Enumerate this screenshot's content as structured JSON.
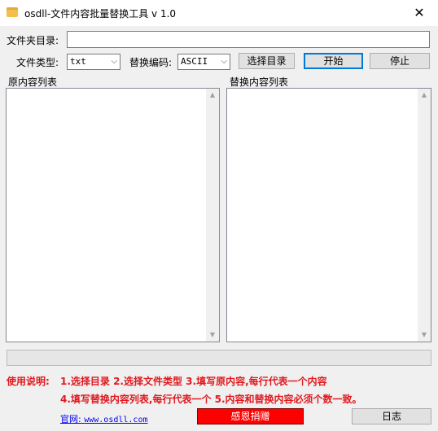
{
  "window": {
    "title": "osdll-文件内容批量替换工具 v 1.0",
    "close_glyph": "✕"
  },
  "form": {
    "folder_label": "文件夹目录:",
    "folder_value": "",
    "filetype_label": "文件类型:",
    "filetype_value": "txt",
    "encoding_label": "替换编码:",
    "encoding_value": "ASCII"
  },
  "buttons": {
    "select_dir": "选择目录",
    "start": "开始",
    "stop": "停止",
    "donate": "感恩捐赠",
    "log": "日志"
  },
  "panels": {
    "original_label": "原内容列表",
    "replace_label": "替换内容列表"
  },
  "instructions": {
    "heading": "使用说明:",
    "line1": "1.选择目录   2.选择文件类型   3.填写原内容,每行代表一个内容",
    "line2": "4.填写替换内容列表,每行代表一个   5.内容和替换内容必须个数一致。"
  },
  "footer": {
    "site_label": "官网:",
    "site_url": "www.osdll.com"
  },
  "icons": {
    "app": "folder-icon",
    "close": "close-icon",
    "dropdown": "chevron-down-icon",
    "scroll_up": "scroll-up-icon",
    "scroll_down": "scroll-down-icon"
  },
  "colors": {
    "instruction_text": "#e0191e",
    "donate_bg": "#ff0000",
    "link": "#0000ee",
    "primary_border": "#0078d7"
  }
}
